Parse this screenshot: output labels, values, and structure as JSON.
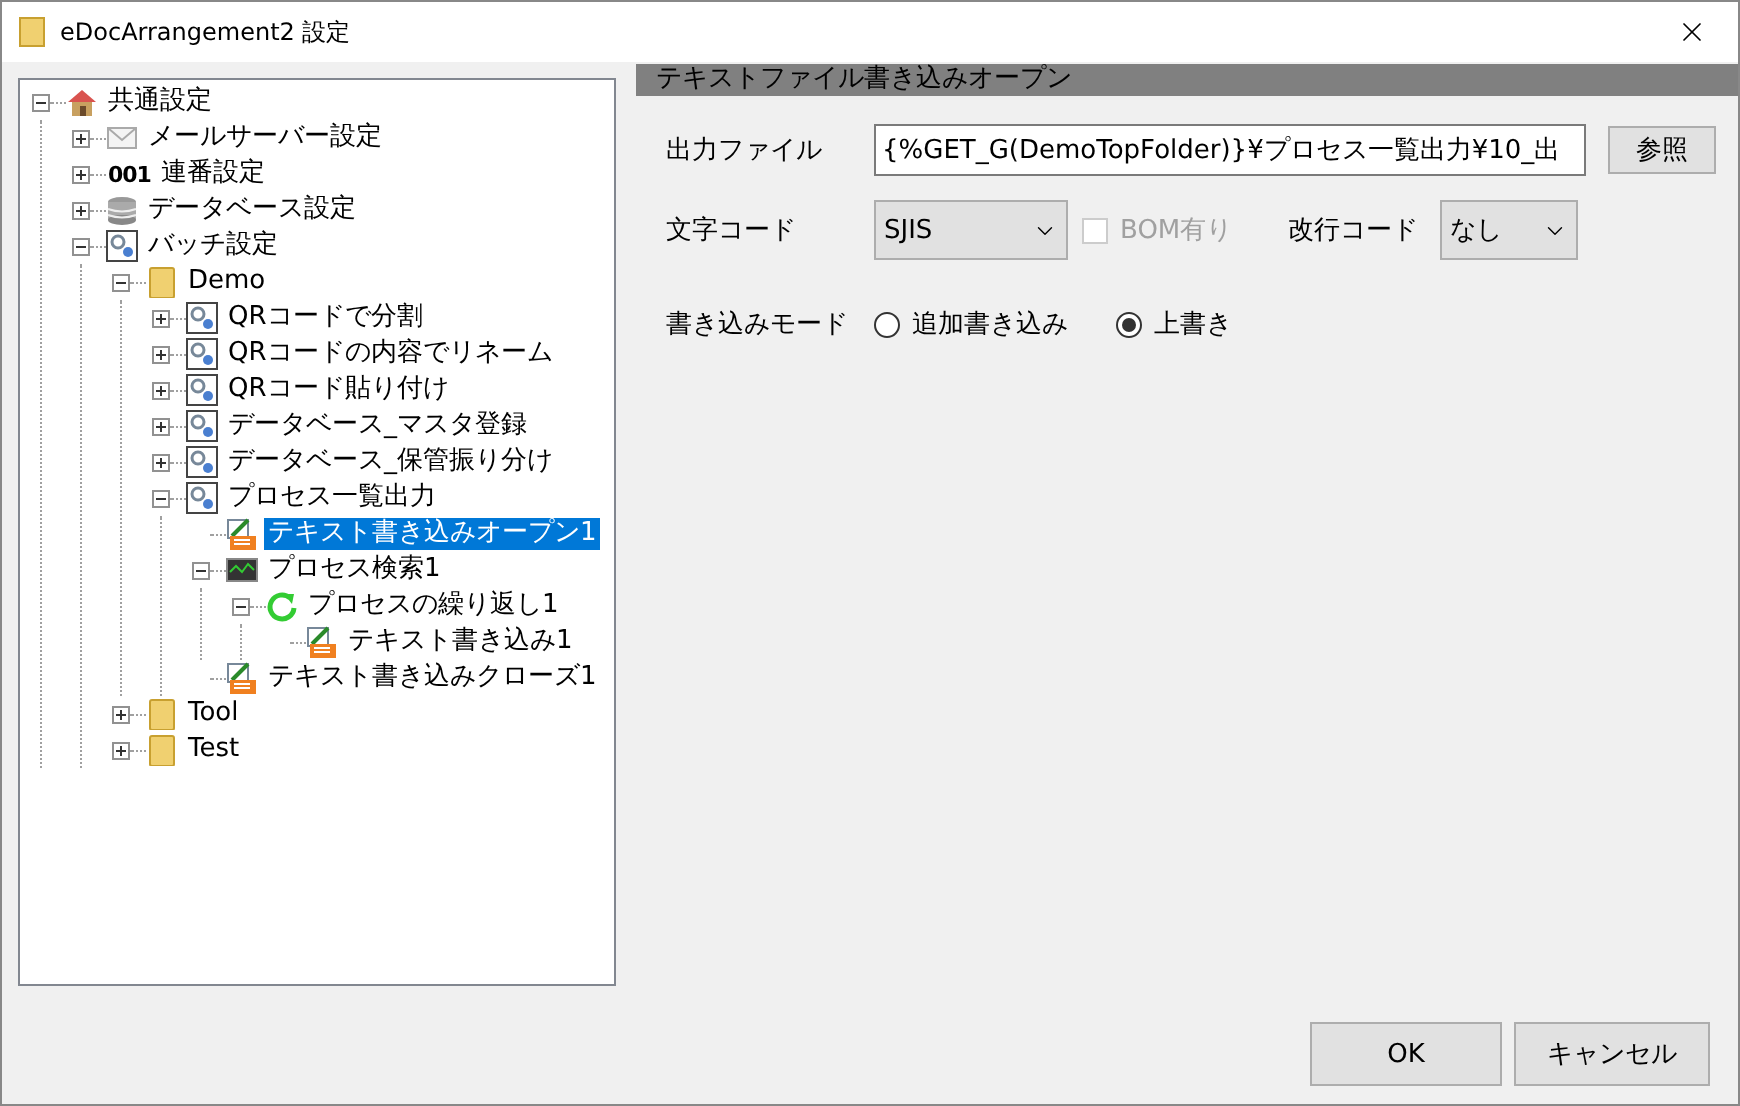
{
  "window": {
    "title": "eDocArrangement2 設定"
  },
  "tree": [
    {
      "label": "共通設定",
      "kind": "home",
      "expanded": true,
      "selected": false,
      "children": [
        {
          "label": "メールサーバー設定",
          "kind": "mail",
          "expanded": false,
          "selected": false
        },
        {
          "label": "連番設定",
          "kind": "sequence",
          "badge": "001",
          "expanded": false,
          "selected": false
        },
        {
          "label": "データベース設定",
          "kind": "database",
          "expanded": false,
          "selected": false
        },
        {
          "label": "バッチ設定",
          "kind": "batch",
          "expanded": true,
          "selected": false,
          "children": [
            {
              "label": "Demo",
              "kind": "folder",
              "expanded": true,
              "selected": false,
              "children": [
                {
                  "label": "QRコードで分割",
                  "kind": "batch",
                  "expanded": false,
                  "selected": false
                },
                {
                  "label": "QRコードの内容でリネーム",
                  "kind": "batch",
                  "expanded": false,
                  "selected": false
                },
                {
                  "label": "QRコード貼り付け",
                  "kind": "batch",
                  "expanded": false,
                  "selected": false
                },
                {
                  "label": "データベース_マスタ登録",
                  "kind": "batch",
                  "expanded": false,
                  "selected": false
                },
                {
                  "label": "データベース_保管振り分け",
                  "kind": "batch",
                  "expanded": false,
                  "selected": false
                },
                {
                  "label": "プロセス一覧出力",
                  "kind": "batch",
                  "expanded": true,
                  "selected": false,
                  "children": [
                    {
                      "label": "テキスト書き込みオープン1",
                      "kind": "textfile",
                      "selected": true
                    },
                    {
                      "label": "プロセス検索1",
                      "kind": "monitor",
                      "expanded": true,
                      "selected": false,
                      "children": [
                        {
                          "label": "プロセスの繰り返し1",
                          "kind": "loop",
                          "expanded": true,
                          "selected": false,
                          "children": [
                            {
                              "label": "テキスト書き込み1",
                              "kind": "textfile",
                              "selected": false
                            }
                          ]
                        }
                      ]
                    },
                    {
                      "label": "テキスト書き込みクローズ1",
                      "kind": "textfile",
                      "selected": false
                    }
                  ]
                }
              ]
            },
            {
              "label": "Tool",
              "kind": "folder",
              "expanded": false,
              "selected": false
            },
            {
              "label": "Test",
              "kind": "folder",
              "expanded": false,
              "selected": false
            }
          ]
        }
      ]
    }
  ],
  "panel": {
    "header": "テキストファイル書き込みオープン",
    "output_file": {
      "label": "出力ファイル",
      "value": "{%GET_G(DemoTopFolder)}¥プロセス一覧出力¥10_出",
      "browse": "参照"
    },
    "encoding": {
      "label": "文字コード",
      "value": "SJIS"
    },
    "bom": {
      "label": "BOM有り",
      "checked": false,
      "disabled": true
    },
    "newline": {
      "label": "改行コード",
      "value": "なし"
    },
    "write_mode": {
      "label": "書き込みモード",
      "options": [
        {
          "label": "追加書き込み",
          "selected": false
        },
        {
          "label": "上書き",
          "selected": true
        }
      ]
    }
  },
  "buttons": [
    {
      "label": "OK"
    },
    {
      "label": "キャンセル"
    }
  ]
}
